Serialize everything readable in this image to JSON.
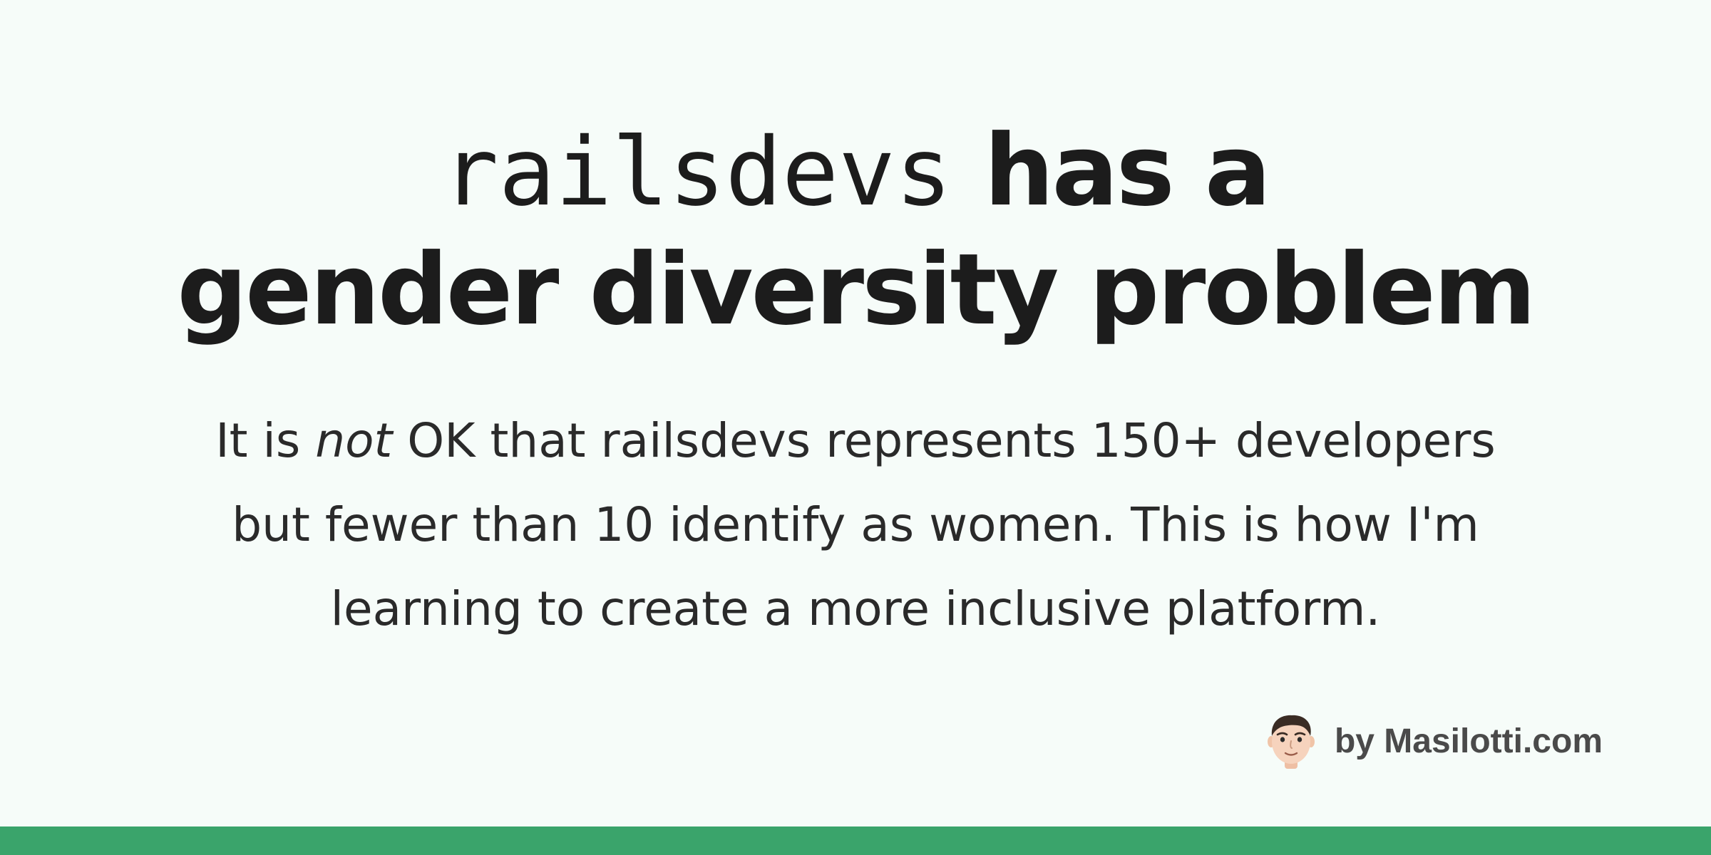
{
  "title": {
    "brand": "railsdevs",
    "line1_rest": "has a",
    "line2": "gender diversity problem"
  },
  "body": {
    "part1": "It is ",
    "emphasis": "not",
    "part2": " OK that railsdevs represents 150+ developers but fewer than 10 identify as women. This is how I'm learning to create a more inclusive platform."
  },
  "byline": {
    "text": "by Masilotti.com",
    "avatar_icon": "memoji-avatar"
  },
  "colors": {
    "background": "#f6fcf9",
    "accent_bar": "#3aa46b",
    "text": "#1c1c1c"
  }
}
